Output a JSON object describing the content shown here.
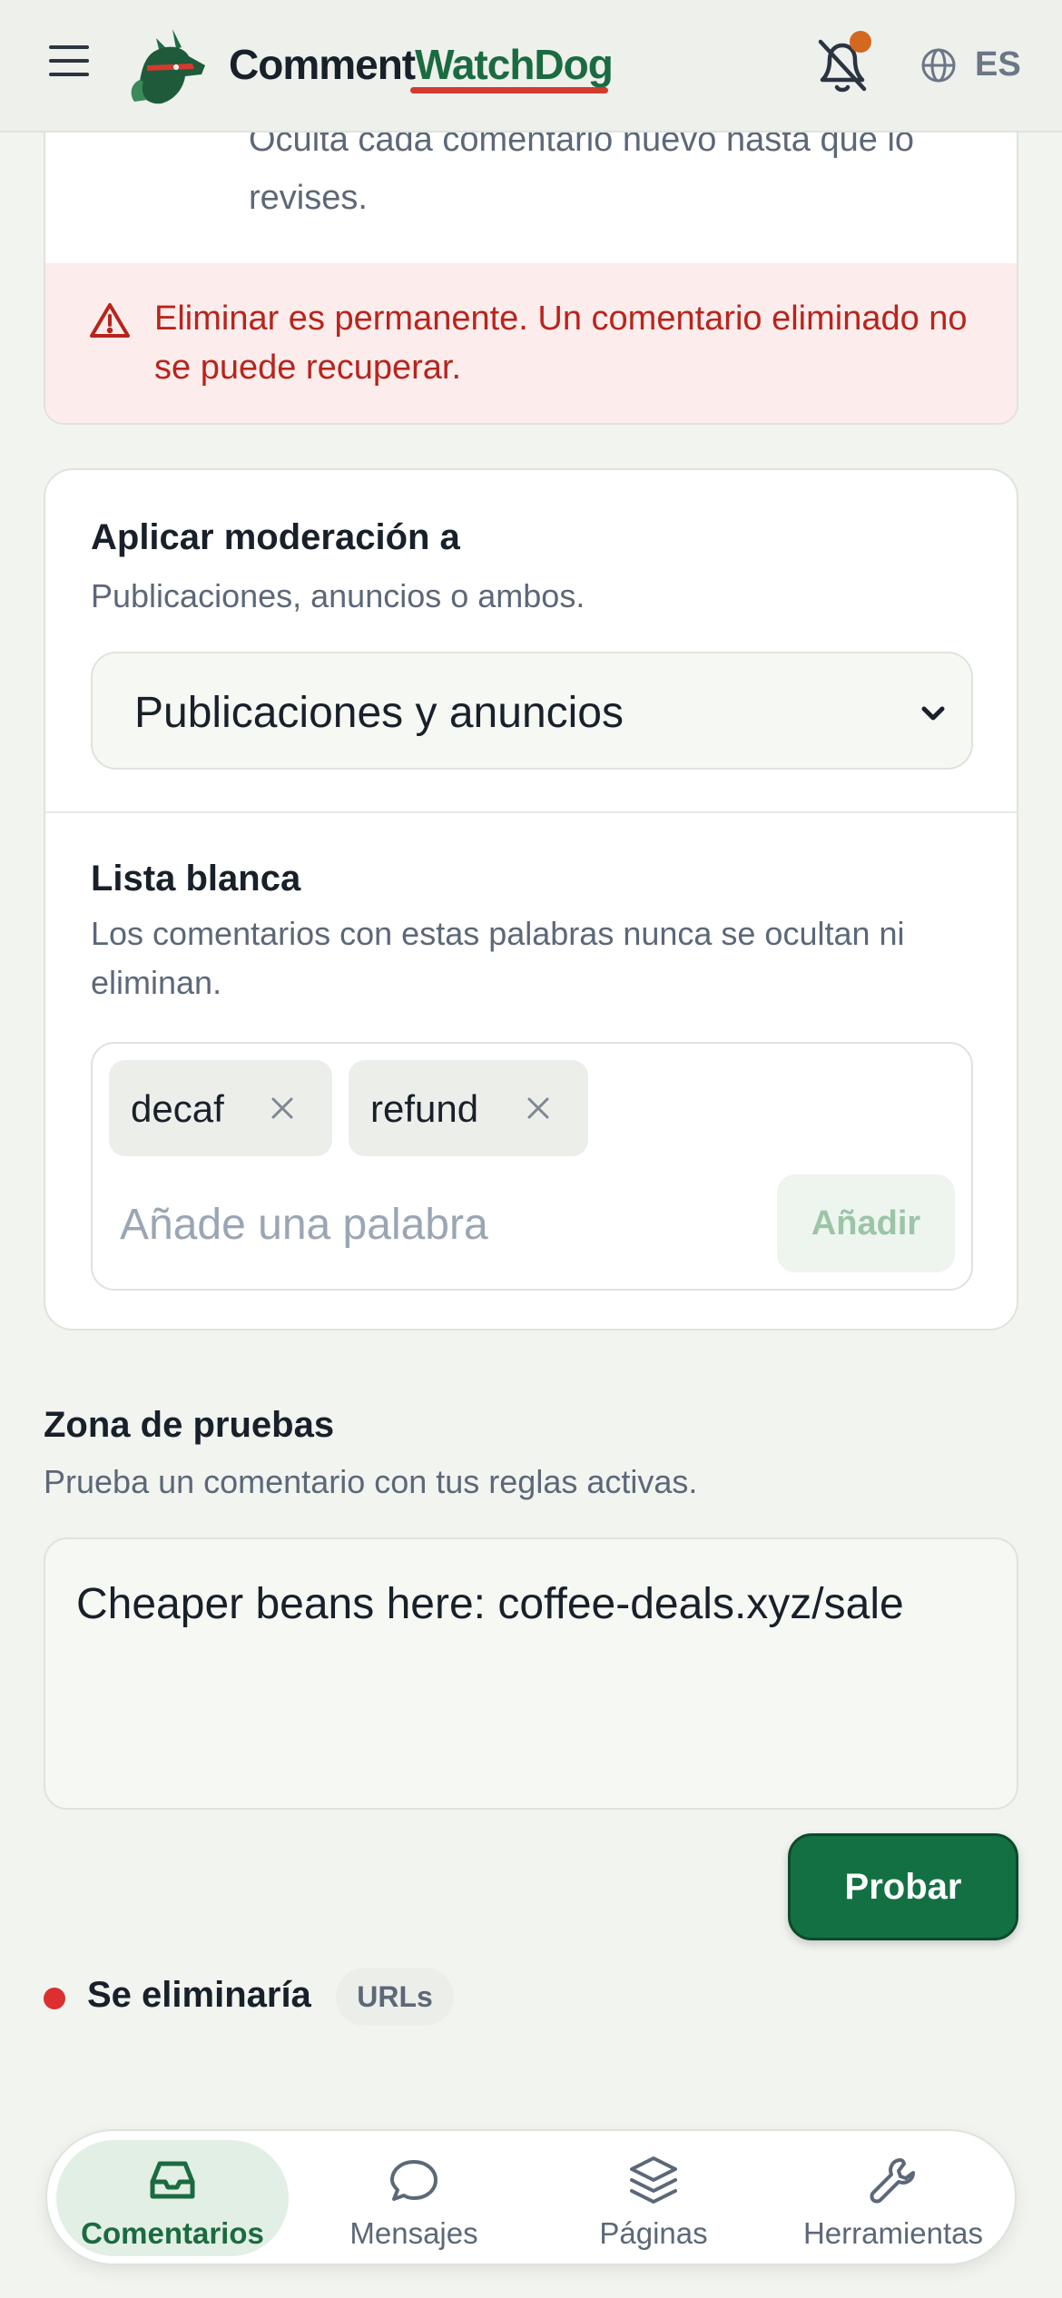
{
  "header": {
    "brand_part1": "Comment",
    "brand_part2": "WatchDog",
    "language": "ES",
    "notification_dot_color": "#d2691e"
  },
  "hide_option": {
    "description": "Oculta cada comentario nuevo hasta que lo revises."
  },
  "warning": {
    "text": "Eliminar es permanente. Un comentario eliminado no se puede recuperar."
  },
  "apply_to": {
    "title": "Aplicar moderación a",
    "subtitle": "Publicaciones, anuncios o ambos.",
    "selected": "Publicaciones y anuncios"
  },
  "whitelist": {
    "title": "Lista blanca",
    "subtitle": "Los comentarios con estas palabras nunca se ocultan ni eliminan.",
    "chips": [
      "decaf",
      "refund"
    ],
    "input_placeholder": "Añade una palabra",
    "add_label": "Añadir"
  },
  "sandbox": {
    "title": "Zona de pruebas",
    "subtitle": "Prueba un comentario con tus reglas activas.",
    "input_value": "Cheaper beans here: coffee-deals.xyz/sale",
    "test_label": "Probar",
    "result_label": "Se eliminaría",
    "result_tag": "URLs",
    "result_color": "#dc3030"
  },
  "nav": {
    "items": [
      {
        "label": "Comentarios",
        "icon": "inbox-icon",
        "active": true
      },
      {
        "label": "Mensajes",
        "icon": "chat-bubble-icon",
        "active": false
      },
      {
        "label": "Páginas",
        "icon": "layers-icon",
        "active": false
      },
      {
        "label": "Herramientas",
        "icon": "wrench-icon",
        "active": false
      }
    ]
  },
  "colors": {
    "brand_green": "#1b6b40",
    "accent_red": "#d43a2f",
    "warning_bg": "#fcecec",
    "warning_text": "#b8241c"
  }
}
